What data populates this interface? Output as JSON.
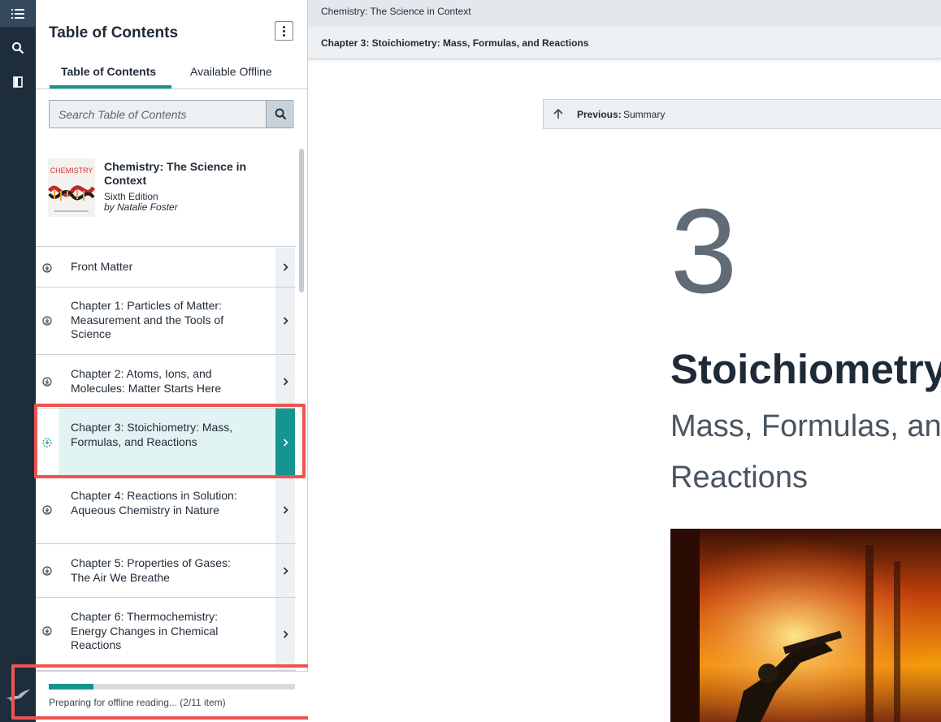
{
  "rail": {
    "items": [
      "toc-icon",
      "search-icon",
      "bookmark-icon"
    ],
    "logo": "bird-logo-icon"
  },
  "toc": {
    "title": "Table of Contents",
    "tabs": [
      "Table of Contents",
      "Available Offline"
    ],
    "search_placeholder": "Search Table of Contents",
    "book": {
      "title": "Chemistry: The Science in Context",
      "edition": "Sixth Edition",
      "author": "by Natalie Foster",
      "cover_word": "CHEMISTRY"
    },
    "items": [
      {
        "label": "Front Matter"
      },
      {
        "label": "Chapter 1: Particles of Matter: Measurement and the Tools of Science"
      },
      {
        "label": "Chapter 2: Atoms, Ions, and Molecules: Matter Starts Here"
      },
      {
        "label": "Chapter 3: Stoichiometry: Mass, Formulas, and Reactions"
      },
      {
        "label": "Chapter 4: Reactions in Solution: Aqueous Chemistry in Nature"
      },
      {
        "label": "Chapter 5: Properties of Gases: The Air We Breathe"
      },
      {
        "label": "Chapter 6: Thermochemistry: Energy Changes in Chemical Reactions"
      }
    ],
    "active_index": 3,
    "progress": {
      "text": "Preparing for offline reading... (2/11 item)",
      "done": 2,
      "total": 11
    }
  },
  "main": {
    "breadcrumb_book": "Chemistry: The Science in Context",
    "breadcrumb_chapter": "Chapter 3: Stoichiometry: Mass, Formulas, and Reactions",
    "previous_label": "Previous:",
    "previous_value": "Summary",
    "chapter_number": "3",
    "chapter_title": "Stoichiometry",
    "chapter_subtitle_line1": "Mass, Formulas, and",
    "chapter_subtitle_line2": "Reactions"
  },
  "colors": {
    "accent": "#16948f",
    "rail": "#1e2d3b",
    "annotation": "#ef5350"
  }
}
